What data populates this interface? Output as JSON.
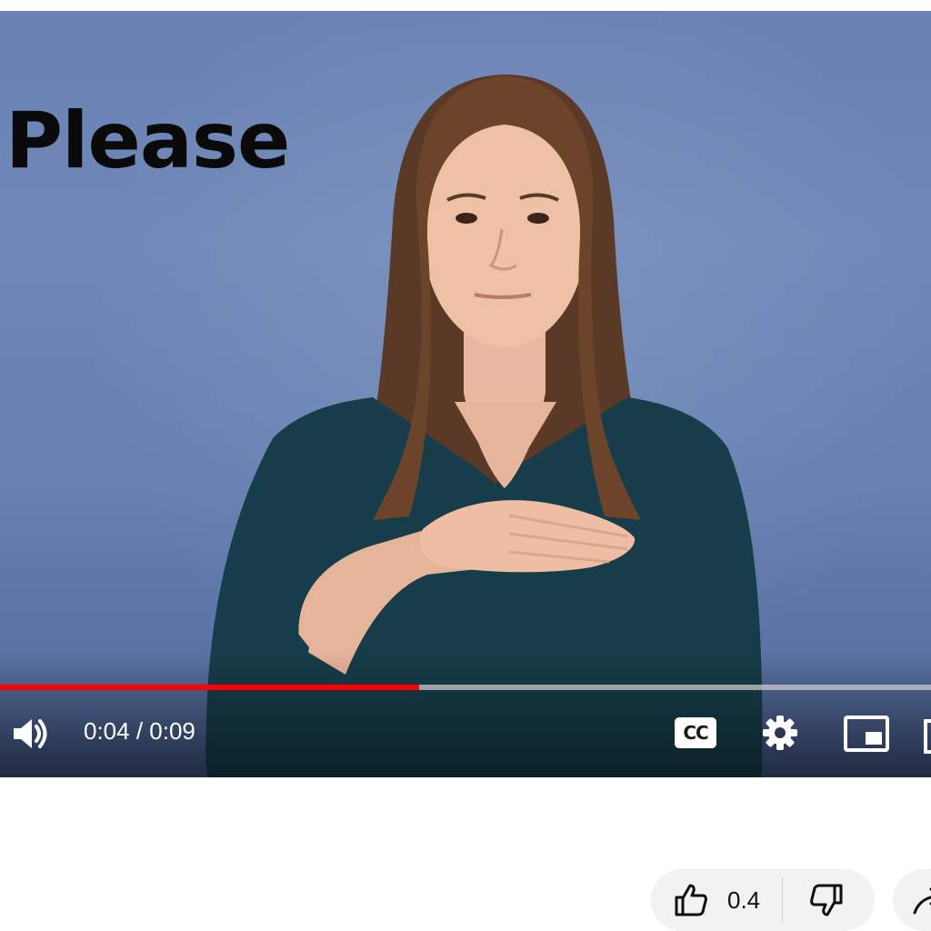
{
  "video": {
    "overlay_text": "Please",
    "progress_fraction": 0.45,
    "current_time": "0:04",
    "duration": "0:09",
    "time_separator": " / "
  },
  "controls": {
    "volume_icon": "volume-icon",
    "captions_label": "CC",
    "settings_icon": "gear-icon",
    "miniplayer_icon": "miniplayer-icon"
  },
  "actions": {
    "like_count": "0.4",
    "like_icon": "thumbs-up-icon",
    "dislike_icon": "thumbs-down-icon",
    "share_icon": "share-icon"
  },
  "colors": {
    "progress": "#ff0000",
    "background": "#6a82b4",
    "shirt": "#123a45"
  }
}
